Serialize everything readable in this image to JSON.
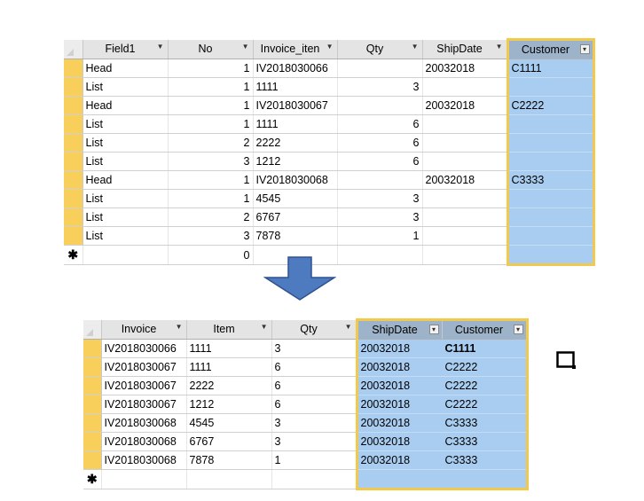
{
  "source": {
    "columns": [
      "Field1",
      "No",
      "Invoice_iten",
      "Qty",
      "ShipDate",
      "Customer"
    ],
    "rows": [
      [
        "Head",
        "1",
        "IV2018030066",
        "",
        "20032018",
        "C1111"
      ],
      [
        "List",
        "1",
        "1111",
        "3",
        "",
        ""
      ],
      [
        "Head",
        "1",
        "IV2018030067",
        "",
        "20032018",
        "C2222"
      ],
      [
        "List",
        "1",
        "1111",
        "6",
        "",
        ""
      ],
      [
        "List",
        "2",
        "2222",
        "6",
        "",
        ""
      ],
      [
        "List",
        "3",
        "1212",
        "6",
        "",
        ""
      ],
      [
        "Head",
        "1",
        "IV2018030068",
        "",
        "20032018",
        "C3333"
      ],
      [
        "List",
        "1",
        "4545",
        "3",
        "",
        ""
      ],
      [
        "List",
        "2",
        "6767",
        "3",
        "",
        ""
      ],
      [
        "List",
        "3",
        "7878",
        "1",
        "",
        ""
      ]
    ],
    "new_row": {
      "marker": "✱",
      "no": "0"
    }
  },
  "result": {
    "columns": [
      "Invoice",
      "Item",
      "Qty",
      "ShipDate",
      "Customer"
    ],
    "rows": [
      [
        "IV2018030066",
        "1111",
        "3",
        "20032018",
        "C1111"
      ],
      [
        "IV2018030067",
        "1111",
        "6",
        "20032018",
        "C2222"
      ],
      [
        "IV2018030067",
        "2222",
        "6",
        "20032018",
        "C2222"
      ],
      [
        "IV2018030067",
        "1212",
        "6",
        "20032018",
        "C2222"
      ],
      [
        "IV2018030068",
        "4545",
        "3",
        "20032018",
        "C3333"
      ],
      [
        "IV2018030068",
        "6767",
        "3",
        "20032018",
        "C3333"
      ],
      [
        "IV2018030068",
        "7878",
        "1",
        "20032018",
        "C3333"
      ]
    ],
    "new_row": {
      "marker": "✱"
    }
  },
  "icons": {
    "arrow": "down-arrow-icon",
    "cursor": "cell-cursor-icon",
    "dropdown": "▾"
  },
  "colors": {
    "highlight_fill": "#a9cdf0",
    "highlight_border": "#f1c94c",
    "selector": "#f8cf5a",
    "arrow_fill": "#4e7ac0"
  }
}
